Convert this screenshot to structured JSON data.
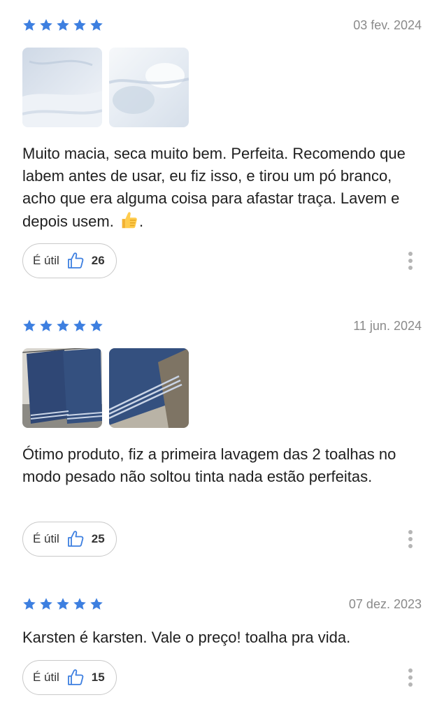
{
  "reviews": [
    {
      "rating": 5,
      "date": "03 fev. 2024",
      "photos": [
        "white-towel-photo-1",
        "white-towel-photo-2"
      ],
      "text": "Muito macia, seca muito bem. Perfeita. Recomendo que labem antes de usar, eu fiz isso, e tirou um pó branco, acho que era alguma coisa para afastar traça. Lavem e depois usem. ",
      "emoji": "thumbs-up-emoji",
      "text_end": ".",
      "helpful_label": "É útil",
      "helpful_count": "26"
    },
    {
      "rating": 5,
      "date": "11 jun. 2024",
      "photos": [
        "blue-towel-photo-1",
        "blue-towel-photo-2"
      ],
      "text": "Ótimo produto, fiz a primeira lavagem das 2 toalhas no modo pesado não soltou tinta nada estão perfeitas.",
      "helpful_label": "É útil",
      "helpful_count": "25"
    },
    {
      "rating": 5,
      "date": "07 dez. 2023",
      "text": "Karsten é karsten. Vale o preço! toalha pra vida.",
      "helpful_label": "É útil",
      "helpful_count": "15"
    }
  ],
  "colors": {
    "star": "#3d7fe0",
    "date": "#8a8a8a",
    "border": "#c9c9c9",
    "thumb_icon": "#3d7fe0"
  }
}
